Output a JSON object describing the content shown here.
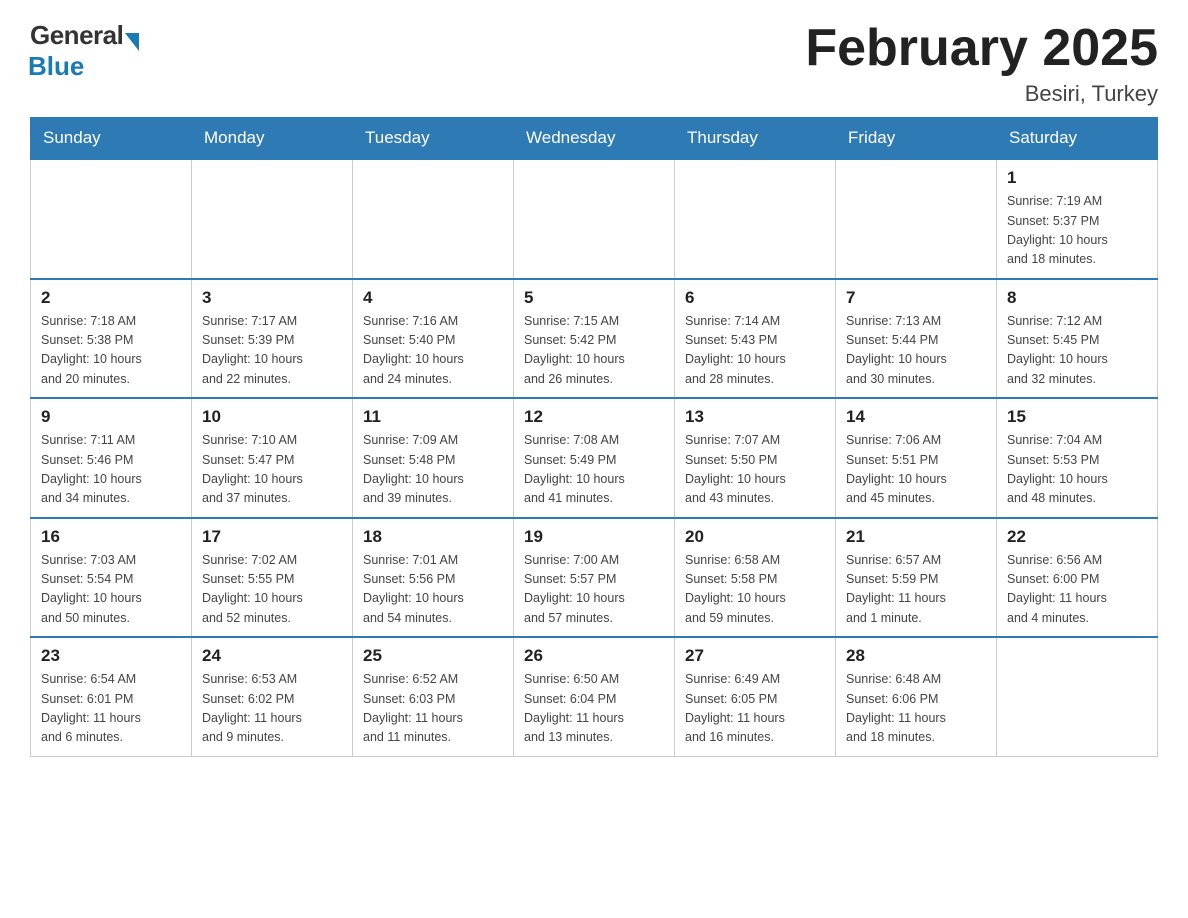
{
  "header": {
    "logo_general": "General",
    "logo_blue": "Blue",
    "month_title": "February 2025",
    "location": "Besiri, Turkey"
  },
  "weekdays": [
    "Sunday",
    "Monday",
    "Tuesday",
    "Wednesday",
    "Thursday",
    "Friday",
    "Saturday"
  ],
  "weeks": [
    [
      {
        "day": "",
        "info": ""
      },
      {
        "day": "",
        "info": ""
      },
      {
        "day": "",
        "info": ""
      },
      {
        "day": "",
        "info": ""
      },
      {
        "day": "",
        "info": ""
      },
      {
        "day": "",
        "info": ""
      },
      {
        "day": "1",
        "info": "Sunrise: 7:19 AM\nSunset: 5:37 PM\nDaylight: 10 hours\nand 18 minutes."
      }
    ],
    [
      {
        "day": "2",
        "info": "Sunrise: 7:18 AM\nSunset: 5:38 PM\nDaylight: 10 hours\nand 20 minutes."
      },
      {
        "day": "3",
        "info": "Sunrise: 7:17 AM\nSunset: 5:39 PM\nDaylight: 10 hours\nand 22 minutes."
      },
      {
        "day": "4",
        "info": "Sunrise: 7:16 AM\nSunset: 5:40 PM\nDaylight: 10 hours\nand 24 minutes."
      },
      {
        "day": "5",
        "info": "Sunrise: 7:15 AM\nSunset: 5:42 PM\nDaylight: 10 hours\nand 26 minutes."
      },
      {
        "day": "6",
        "info": "Sunrise: 7:14 AM\nSunset: 5:43 PM\nDaylight: 10 hours\nand 28 minutes."
      },
      {
        "day": "7",
        "info": "Sunrise: 7:13 AM\nSunset: 5:44 PM\nDaylight: 10 hours\nand 30 minutes."
      },
      {
        "day": "8",
        "info": "Sunrise: 7:12 AM\nSunset: 5:45 PM\nDaylight: 10 hours\nand 32 minutes."
      }
    ],
    [
      {
        "day": "9",
        "info": "Sunrise: 7:11 AM\nSunset: 5:46 PM\nDaylight: 10 hours\nand 34 minutes."
      },
      {
        "day": "10",
        "info": "Sunrise: 7:10 AM\nSunset: 5:47 PM\nDaylight: 10 hours\nand 37 minutes."
      },
      {
        "day": "11",
        "info": "Sunrise: 7:09 AM\nSunset: 5:48 PM\nDaylight: 10 hours\nand 39 minutes."
      },
      {
        "day": "12",
        "info": "Sunrise: 7:08 AM\nSunset: 5:49 PM\nDaylight: 10 hours\nand 41 minutes."
      },
      {
        "day": "13",
        "info": "Sunrise: 7:07 AM\nSunset: 5:50 PM\nDaylight: 10 hours\nand 43 minutes."
      },
      {
        "day": "14",
        "info": "Sunrise: 7:06 AM\nSunset: 5:51 PM\nDaylight: 10 hours\nand 45 minutes."
      },
      {
        "day": "15",
        "info": "Sunrise: 7:04 AM\nSunset: 5:53 PM\nDaylight: 10 hours\nand 48 minutes."
      }
    ],
    [
      {
        "day": "16",
        "info": "Sunrise: 7:03 AM\nSunset: 5:54 PM\nDaylight: 10 hours\nand 50 minutes."
      },
      {
        "day": "17",
        "info": "Sunrise: 7:02 AM\nSunset: 5:55 PM\nDaylight: 10 hours\nand 52 minutes."
      },
      {
        "day": "18",
        "info": "Sunrise: 7:01 AM\nSunset: 5:56 PM\nDaylight: 10 hours\nand 54 minutes."
      },
      {
        "day": "19",
        "info": "Sunrise: 7:00 AM\nSunset: 5:57 PM\nDaylight: 10 hours\nand 57 minutes."
      },
      {
        "day": "20",
        "info": "Sunrise: 6:58 AM\nSunset: 5:58 PM\nDaylight: 10 hours\nand 59 minutes."
      },
      {
        "day": "21",
        "info": "Sunrise: 6:57 AM\nSunset: 5:59 PM\nDaylight: 11 hours\nand 1 minute."
      },
      {
        "day": "22",
        "info": "Sunrise: 6:56 AM\nSunset: 6:00 PM\nDaylight: 11 hours\nand 4 minutes."
      }
    ],
    [
      {
        "day": "23",
        "info": "Sunrise: 6:54 AM\nSunset: 6:01 PM\nDaylight: 11 hours\nand 6 minutes."
      },
      {
        "day": "24",
        "info": "Sunrise: 6:53 AM\nSunset: 6:02 PM\nDaylight: 11 hours\nand 9 minutes."
      },
      {
        "day": "25",
        "info": "Sunrise: 6:52 AM\nSunset: 6:03 PM\nDaylight: 11 hours\nand 11 minutes."
      },
      {
        "day": "26",
        "info": "Sunrise: 6:50 AM\nSunset: 6:04 PM\nDaylight: 11 hours\nand 13 minutes."
      },
      {
        "day": "27",
        "info": "Sunrise: 6:49 AM\nSunset: 6:05 PM\nDaylight: 11 hours\nand 16 minutes."
      },
      {
        "day": "28",
        "info": "Sunrise: 6:48 AM\nSunset: 6:06 PM\nDaylight: 11 hours\nand 18 minutes."
      },
      {
        "day": "",
        "info": ""
      }
    ]
  ]
}
